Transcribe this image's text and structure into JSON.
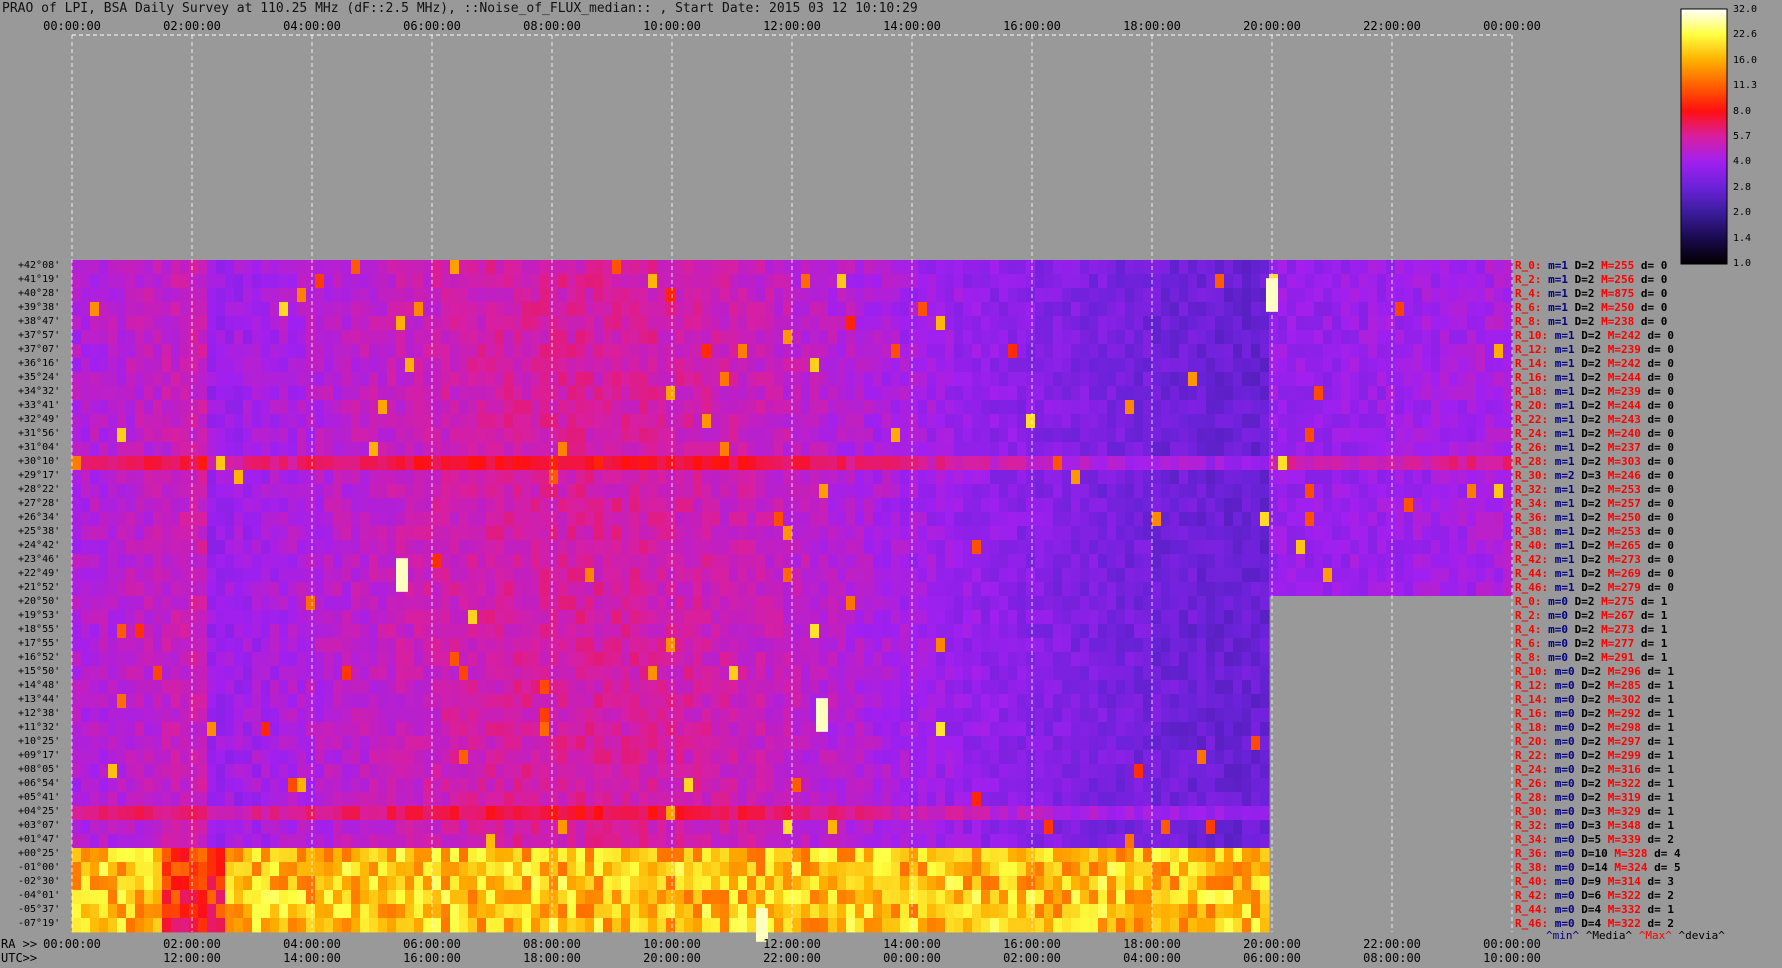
{
  "title": "PRAO of LPI, BSA Daily Survey at 110.25 MHz (dF::2.5 MHz), ::Noise_of_FLUX_median:: , Start Date: 2015 03 12 10:10:29",
  "top_axis_ticks": [
    "00:00:00",
    "02:00:00",
    "04:00:00",
    "06:00:00",
    "08:00:00",
    "10:00:00",
    "12:00:00",
    "14:00:00",
    "16:00:00",
    "18:00:00",
    "20:00:00",
    "22:00:00",
    "00:00:00"
  ],
  "ra_axis": {
    "label": "RA >>",
    "ticks": [
      "00:00:00",
      "02:00:00",
      "04:00:00",
      "06:00:00",
      "08:00:00",
      "10:00:00",
      "12:00:00",
      "14:00:00",
      "16:00:00",
      "18:00:00",
      "20:00:00",
      "22:00:00",
      "00:00:00"
    ]
  },
  "utc_axis": {
    "label": "UTC>>",
    "ticks": [
      "12:00:00",
      "14:00:00",
      "16:00:00",
      "18:00:00",
      "20:00:00",
      "22:00:00",
      "00:00:00",
      "02:00:00",
      "04:00:00",
      "06:00:00",
      "08:00:00",
      "10:00:00"
    ]
  },
  "declinations": [
    "+42°08'",
    "+41°19'",
    "+40°28'",
    "+39°38'",
    "+38°47'",
    "+37°57'",
    "+37°07'",
    "+36°16'",
    "+35°24'",
    "+34°32'",
    "+33°41'",
    "+32°49'",
    "+31°56'",
    "+31°04'",
    "+30°10'",
    "+29°17'",
    "+28°22'",
    "+27°28'",
    "+26°34'",
    "+25°38'",
    "+24°42'",
    "+23°46'",
    "+22°49'",
    "+21°52'",
    "+20°50'",
    "+19°53'",
    "+18°55'",
    "+17°55'",
    "+16°52'",
    "+15°50'",
    "+14°48'",
    "+13°44'",
    "+12°38'",
    "+11°32'",
    "+10°25'",
    "+09°17'",
    "+08°05'",
    "+06°54'",
    "+05°41'",
    "+04°25'",
    "+03°07'",
    "+01°47'",
    "+00°25'",
    "-01°00'",
    "-02°30'",
    "-04°01'",
    "-05°37'",
    "-07°19'"
  ],
  "colorbar": {
    "ticks": [
      "32.0",
      "22.6",
      "16.0",
      "11.3",
      "8.0",
      "5.7",
      "4.0",
      "2.8",
      "2.0",
      "1.4",
      "1.0"
    ],
    "colors": [
      "#000000",
      "#1a0a4d",
      "#3a1c9a",
      "#6a22d8",
      "#a020f0",
      "#d81fa0",
      "#ff1010",
      "#ff6000",
      "#ffb000",
      "#ffff40",
      "#ffffff"
    ]
  },
  "stats": [
    {
      "r": "R_0:",
      "m": "m=1",
      "d": "D=2",
      "x": "M=255",
      "dv": "d= 0"
    },
    {
      "r": "R_2:",
      "m": "m=1",
      "d": "D=2",
      "x": "M=256",
      "dv": "d= 0"
    },
    {
      "r": "R_4:",
      "m": "m=1",
      "d": "D=2",
      "x": "M=875",
      "dv": "d= 0"
    },
    {
      "r": "R_6:",
      "m": "m=1",
      "d": "D=2",
      "x": "M=250",
      "dv": "d= 0"
    },
    {
      "r": "R_8:",
      "m": "m=1",
      "d": "D=2",
      "x": "M=238",
      "dv": "d= 0"
    },
    {
      "r": "R_10:",
      "m": "m=1",
      "d": "D=2",
      "x": "M=242",
      "dv": "d= 0"
    },
    {
      "r": "R_12:",
      "m": "m=1",
      "d": "D=2",
      "x": "M=239",
      "dv": "d= 0"
    },
    {
      "r": "R_14:",
      "m": "m=1",
      "d": "D=2",
      "x": "M=242",
      "dv": "d= 0"
    },
    {
      "r": "R_16:",
      "m": "m=1",
      "d": "D=2",
      "x": "M=244",
      "dv": "d= 0"
    },
    {
      "r": "R_18:",
      "m": "m=1",
      "d": "D=2",
      "x": "M=239",
      "dv": "d= 0"
    },
    {
      "r": "R_20:",
      "m": "m=1",
      "d": "D=2",
      "x": "M=244",
      "dv": "d= 0"
    },
    {
      "r": "R_22:",
      "m": "m=1",
      "d": "D=2",
      "x": "M=243",
      "dv": "d= 0"
    },
    {
      "r": "R_24:",
      "m": "m=1",
      "d": "D=2",
      "x": "M=240",
      "dv": "d= 0"
    },
    {
      "r": "R_26:",
      "m": "m=1",
      "d": "D=2",
      "x": "M=237",
      "dv": "d= 0"
    },
    {
      "r": "R_28:",
      "m": "m=1",
      "d": "D=2",
      "x": "M=303",
      "dv": "d= 0"
    },
    {
      "r": "R_30:",
      "m": "m=2",
      "d": "D=3",
      "x": "M=246",
      "dv": "d= 0"
    },
    {
      "r": "R_32:",
      "m": "m=1",
      "d": "D=2",
      "x": "M=253",
      "dv": "d= 0"
    },
    {
      "r": "R_34:",
      "m": "m=1",
      "d": "D=2",
      "x": "M=257",
      "dv": "d= 0"
    },
    {
      "r": "R_36:",
      "m": "m=1",
      "d": "D=2",
      "x": "M=250",
      "dv": "d= 0"
    },
    {
      "r": "R_38:",
      "m": "m=1",
      "d": "D=2",
      "x": "M=253",
      "dv": "d= 0"
    },
    {
      "r": "R_40:",
      "m": "m=1",
      "d": "D=2",
      "x": "M=265",
      "dv": "d= 0"
    },
    {
      "r": "R_42:",
      "m": "m=1",
      "d": "D=2",
      "x": "M=273",
      "dv": "d= 0"
    },
    {
      "r": "R_44:",
      "m": "m=1",
      "d": "D=2",
      "x": "M=269",
      "dv": "d= 0"
    },
    {
      "r": "R_46:",
      "m": "m=1",
      "d": "D=2",
      "x": "M=279",
      "dv": "d= 0"
    },
    {
      "r": "R_0:",
      "m": "m=0",
      "d": "D=2",
      "x": "M=275",
      "dv": "d= 1"
    },
    {
      "r": "R_2:",
      "m": "m=0",
      "d": "D=2",
      "x": "M=267",
      "dv": "d= 1"
    },
    {
      "r": "R_4:",
      "m": "m=0",
      "d": "D=2",
      "x": "M=273",
      "dv": "d= 1"
    },
    {
      "r": "R_6:",
      "m": "m=0",
      "d": "D=2",
      "x": "M=277",
      "dv": "d= 1"
    },
    {
      "r": "R_8:",
      "m": "m=0",
      "d": "D=2",
      "x": "M=291",
      "dv": "d= 1"
    },
    {
      "r": "R_10:",
      "m": "m=0",
      "d": "D=2",
      "x": "M=296",
      "dv": "d= 1"
    },
    {
      "r": "R_12:",
      "m": "m=0",
      "d": "D=2",
      "x": "M=285",
      "dv": "d= 1"
    },
    {
      "r": "R_14:",
      "m": "m=0",
      "d": "D=2",
      "x": "M=302",
      "dv": "d= 1"
    },
    {
      "r": "R_16:",
      "m": "m=0",
      "d": "D=2",
      "x": "M=292",
      "dv": "d= 1"
    },
    {
      "r": "R_18:",
      "m": "m=0",
      "d": "D=2",
      "x": "M=298",
      "dv": "d= 1"
    },
    {
      "r": "R_20:",
      "m": "m=0",
      "d": "D=2",
      "x": "M=297",
      "dv": "d= 1"
    },
    {
      "r": "R_22:",
      "m": "m=0",
      "d": "D=2",
      "x": "M=299",
      "dv": "d= 1"
    },
    {
      "r": "R_24:",
      "m": "m=0",
      "d": "D=2",
      "x": "M=316",
      "dv": "d= 1"
    },
    {
      "r": "R_26:",
      "m": "m=0",
      "d": "D=2",
      "x": "M=322",
      "dv": "d= 1"
    },
    {
      "r": "R_28:",
      "m": "m=0",
      "d": "D=2",
      "x": "M=319",
      "dv": "d= 1"
    },
    {
      "r": "R_30:",
      "m": "m=0",
      "d": "D=3",
      "x": "M=329",
      "dv": "d= 1"
    },
    {
      "r": "R_32:",
      "m": "m=0",
      "d": "D=3",
      "x": "M=348",
      "dv": "d= 1"
    },
    {
      "r": "R_34:",
      "m": "m=0",
      "d": "D=5",
      "x": "M=339",
      "dv": "d= 2"
    },
    {
      "r": "R_36:",
      "m": "m=0",
      "d": "D=10",
      "x": "M=328",
      "dv": "d= 4"
    },
    {
      "r": "R_38:",
      "m": "m=0",
      "d": "D=14",
      "x": "M=324",
      "dv": "d= 5"
    },
    {
      "r": "R_40:",
      "m": "m=0",
      "d": "D=9",
      "x": "M=314",
      "dv": "d= 3"
    },
    {
      "r": "R_42:",
      "m": "m=0",
      "d": "D=6",
      "x": "M=322",
      "dv": "d= 2"
    },
    {
      "r": "R_44:",
      "m": "m=0",
      "d": "D=4",
      "x": "M=332",
      "dv": "d= 1"
    },
    {
      "r": "R_46:",
      "m": "m=0",
      "d": "D=4",
      "x": "M=322",
      "dv": "d= 2"
    }
  ],
  "legend": {
    "min": "^min^",
    "median": "^Media^",
    "max": "^Max^",
    "dev": "^devia^"
  },
  "chart_data": {
    "type": "heatmap",
    "title": "PRAO of LPI, BSA Daily Survey at 110.25 MHz (dF::2.5 MHz), ::Noise_of_FLUX_median:: , Start Date: 2015 03 12 10:10:29",
    "xlabel": "RA",
    "x_range": [
      "00:00:00",
      "00:00:00"
    ],
    "rows": 48,
    "color_scale": "log",
    "color_range": [
      1.0,
      32.0
    ],
    "missing_block": {
      "ra_from": "20:00:00",
      "ra_to": "00:00:00",
      "rows_from": 24,
      "rows_to": 47
    },
    "bright_band_declinations": [
      "+00°25'",
      "-07°19'"
    ],
    "bright_sources": [
      {
        "ra": "20:00:00",
        "dec": "+40°28'"
      },
      {
        "ra": "05:30:00",
        "dec": "+22°49'"
      },
      {
        "ra": "12:30:00",
        "dec": "+12°38'"
      },
      {
        "ra": "11:30:00",
        "dec": "-07°19'"
      }
    ]
  }
}
